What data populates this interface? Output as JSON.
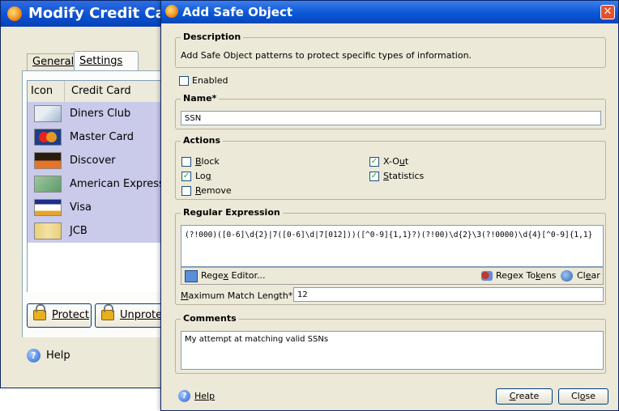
{
  "bg_window": {
    "title": "Modify Credit Ca",
    "tabs": {
      "general": "General",
      "settings": "Settings"
    },
    "table": {
      "headers": {
        "icon": "Icon",
        "card": "Credit Card"
      },
      "rows": [
        {
          "name": "Diners Club",
          "icon": "diners-club-card-icon"
        },
        {
          "name": "Master Card",
          "icon": "mastercard-card-icon"
        },
        {
          "name": "Discover",
          "icon": "discover-card-icon"
        },
        {
          "name": "American Express",
          "icon": "amex-card-icon"
        },
        {
          "name": "Visa",
          "icon": "visa-card-icon"
        },
        {
          "name": "JCB",
          "icon": "jcb-card-icon"
        }
      ]
    },
    "buttons": {
      "protect": "Protect",
      "unprotect": "Unprote"
    },
    "help": "Help"
  },
  "dialog": {
    "title": "Add Safe Object",
    "close_glyph": "✕",
    "description": {
      "legend": "Description",
      "text": "Add Safe Object patterns to protect specific types of information."
    },
    "enabled": {
      "label": "Enabled",
      "checked": false
    },
    "name": {
      "legend": "Name*",
      "value": "SSN"
    },
    "actions": {
      "legend": "Actions",
      "block": {
        "label": "Block",
        "checked": false
      },
      "log": {
        "label": "Log",
        "checked": true
      },
      "remove": {
        "label": "Remove",
        "checked": false
      },
      "xout": {
        "label": "X-Out",
        "checked": true
      },
      "statistics": {
        "label": "Statistics",
        "checked": true
      }
    },
    "regex": {
      "legend": "Regular Expression",
      "value": "(?!000)([0-6]\\d{2}|7([0-6]\\d|7[012]))([^0-9]{1,1}?)(?!00)\\d{2}\\3(?!0000)\\d{4}[^0-9]{1,1}",
      "editor_button": "Regex Editor...",
      "tokens_button": "Regex Tokens",
      "clear_button": "Clear",
      "max_label": "Maximum Match Length*",
      "max_value": "12"
    },
    "comments": {
      "legend": "Comments",
      "value": "My attempt at matching valid SSNs"
    },
    "footer": {
      "help": "Help",
      "create": "Create",
      "close": "Close"
    }
  },
  "colors": {
    "titlebar": "#0a56d8",
    "selected_row": "#cacaea",
    "dialog_bg": "#ece9d8"
  }
}
